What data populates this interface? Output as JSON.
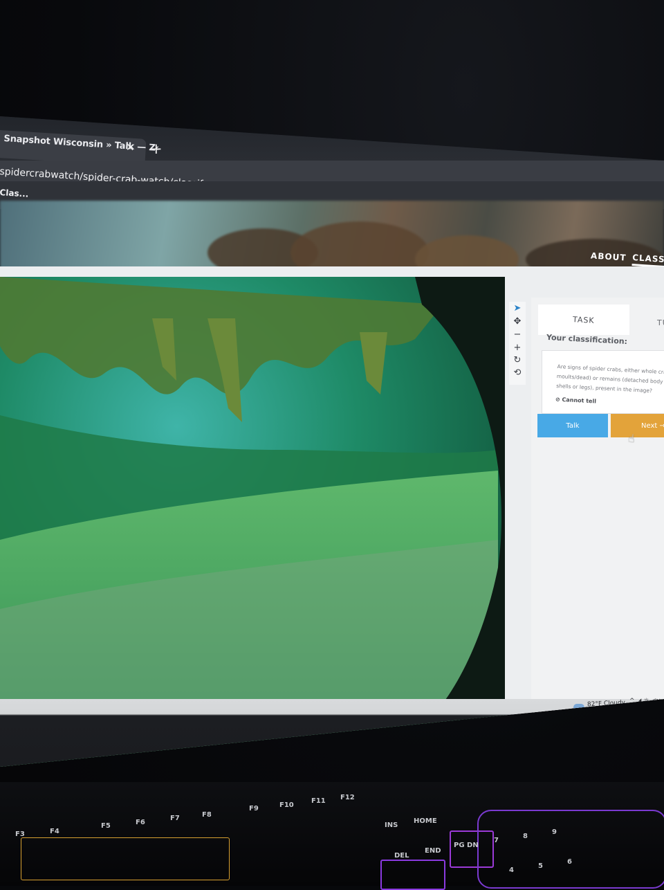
{
  "browser": {
    "tab_title": "Snapshot Wisconsin » Talk — Z‹",
    "tab_close_icon": "close-icon",
    "new_tab_icon": "plus-icon",
    "url": "spidercrabwatch/spider-crab-watch/classify",
    "bookmark": "Clas...",
    "bookmark_star_icon": "star-icon"
  },
  "site_nav": {
    "about": "ABOUT",
    "classify": "CLASSIF"
  },
  "image_toolbar": {
    "tools": [
      "pointer-icon",
      "move-icon",
      "zoom-out-icon",
      "zoom-in-icon",
      "rotate-icon",
      "reset-icon"
    ]
  },
  "task_panel": {
    "task_tab": "TASK",
    "tutorial_tab": "TU",
    "your_classification": "Your classification:",
    "question": "Are signs of spider crabs, either whole cra moults/dead) or remains (detached body shells or legs), present in the image?",
    "cannot_tell": "Cannot tell",
    "talk_button": "Talk",
    "next_button": "Next →"
  },
  "taskbar": {
    "weather": "82°F  Cloudy",
    "tray": "^ ◢ ☼ ◁×"
  },
  "keyboard": {
    "keys": [
      "F3",
      "F4",
      "F5",
      "F6",
      "F7",
      "F8",
      "F9",
      "F10",
      "F11",
      "F12",
      "INS",
      "HOME",
      "DEL",
      "END",
      "PG DN",
      "7",
      "8",
      "9",
      "4",
      "5",
      "6"
    ]
  }
}
